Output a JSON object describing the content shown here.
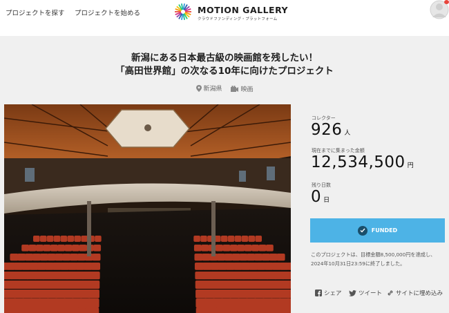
{
  "header": {
    "nav": [
      {
        "label": "プロジェクトを探す"
      },
      {
        "label": "プロジェクトを始める"
      }
    ],
    "logo": {
      "title": "MOTION GALLERY",
      "subtitle": "クラウドファンディング・プラットフォーム"
    },
    "avatar_icon": "user-avatar-icon"
  },
  "project": {
    "title_line1": "新潟にある日本最古級の映画館を残したい！",
    "title_line2": "「高田世界館」の次なる10年に向けたプロジェクト",
    "location": "新潟県",
    "category": "映画",
    "location_icon": "location-pin-icon",
    "category_icon": "film-icon"
  },
  "stats": {
    "collectors_label": "コレクター",
    "collectors_value": "926",
    "collectors_unit": "人",
    "amount_label": "現在までに集まった金額",
    "amount_value": "12,534,500",
    "amount_unit": "円",
    "days_label": "残り日数",
    "days_value": "0",
    "days_unit": "日"
  },
  "funded": {
    "label": "FUNDED",
    "color": "#4db3e6"
  },
  "note": "このプロジェクトは、目標金額8,500,000円を達成し、2024年10月31日23:59に終了しました。",
  "share": {
    "facebook": "シェア",
    "twitter": "ツイート",
    "embed": "サイトに埋め込み"
  }
}
